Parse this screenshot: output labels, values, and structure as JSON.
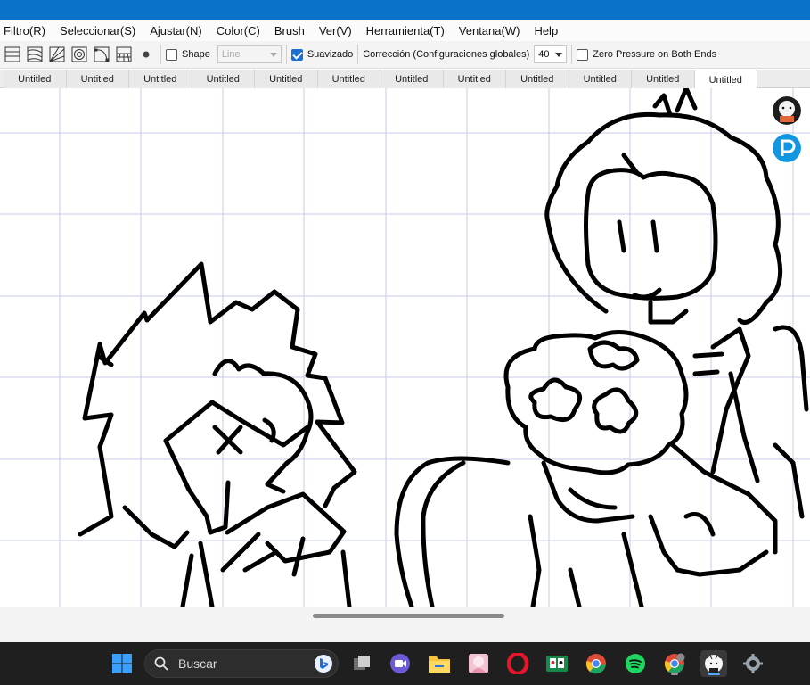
{
  "menubar": {
    "items": [
      "Filtro(R)",
      "Seleccionar(S)",
      "Ajustar(N)",
      "Color(C)",
      "Brush",
      "Ver(V)",
      "Herramienta(T)",
      "Ventana(W)",
      "Help"
    ]
  },
  "toolbar": {
    "shape_label": "Shape",
    "shape_checked": false,
    "shape_type_value": "Line",
    "smoothing_label": "Suavizado",
    "smoothing_checked": true,
    "correction_label": "Corrección (Configuraciones globales)",
    "correction_value": "40",
    "zero_pressure_label": "Zero Pressure on Both Ends",
    "zero_pressure_checked": false
  },
  "tabs": [
    "Untitled",
    "Untitled",
    "Untitled",
    "Untitled",
    "Untitled",
    "Untitled",
    "Untitled",
    "Untitled",
    "Untitled",
    "Untitled",
    "Untitled",
    "Untitled"
  ],
  "active_tab_index": 11,
  "taskbar": {
    "search_placeholder": "Buscar",
    "apps": [
      "start-icon",
      "task-view-icon",
      "meet-icon",
      "file-explorer-icon",
      "photo-app-icon",
      "opera-icon",
      "solitaire-icon",
      "chrome-icon",
      "spotify-icon",
      "chrome-profile-icon",
      "medibang-icon",
      "settings-icon"
    ]
  },
  "colors": {
    "titlebar": "#0a73c9",
    "taskbar": "#1f1f1f",
    "grid": "#c9cbe6",
    "accent": "#1a6fd0"
  }
}
